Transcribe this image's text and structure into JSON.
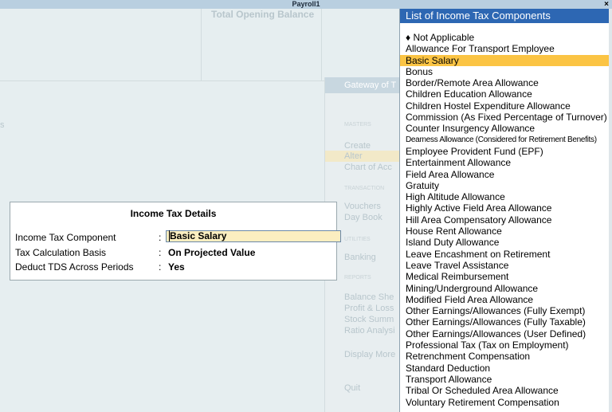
{
  "window": {
    "title": "Payroll1",
    "close_glyph": "×"
  },
  "background": {
    "top_panel_title": "Total Opening Balance",
    "left_label": "s",
    "gateway": {
      "header": "Gateway of T",
      "section_masters": "MASTERS",
      "create": "Create",
      "alter": "Alter",
      "chart": "Chart of Acc",
      "section_transactions": "TRANSACTION",
      "vouchers": "Vouchers",
      "daybook": "Day Book",
      "section_utilities": "UTILITIES",
      "banking": "Banking",
      "section_reports": "REPORTS",
      "balance_sheet": "Balance She",
      "profit_loss": "Profit & Loss",
      "stock_summary": "Stock Summ",
      "ratio": "Ratio Analysi",
      "display_more": "Display More",
      "quit": "Quit"
    }
  },
  "tax_details": {
    "title": "Income Tax Details",
    "rows": [
      {
        "label": "Income Tax Component",
        "colon": ":",
        "value": "Basic Salary"
      },
      {
        "label": "Tax Calculation Basis",
        "colon": ":",
        "value": "On Projected Value"
      },
      {
        "label": "Deduct TDS Across Periods",
        "colon": ":",
        "value": "Yes"
      }
    ],
    "cursor_char": "B",
    "value_rest": "asic Salary"
  },
  "list": {
    "title": "List of Income Tax Components",
    "items": [
      "♦ Not Applicable",
      "Allowance For Transport Employee",
      "Basic Salary",
      "Bonus",
      "Border/Remote Area Allowance",
      "Children Education Allowance",
      "Children Hostel Expenditure Allowance",
      "Commission (As Fixed Percentage of Turnover)",
      "Counter Insurgency Allowance",
      "Dearness Allowance (Considered for Retirement Benefits)",
      "Employee Provident Fund (EPF)",
      "Entertainment Allowance",
      "Field Area Allowance",
      "Gratuity",
      "High Altitude Allowance",
      "Highly Active Field Area Allowance",
      "Hill Area Compensatory Allowance",
      "House Rent Allowance",
      "Island Duty Allowance",
      "Leave Encashment on Retirement",
      "Leave Travel Assistance",
      "Medical Reimbursement",
      "Mining/Underground Allowance",
      "Modified Field Area Allowance",
      "Other Earnings/Allowances (Fully Exempt)",
      "Other Earnings/Allowances (Fully Taxable)",
      "Other Earnings/Allowances (User Defined)",
      "Professional Tax (Tax on Employment)",
      "Retrenchment Compensation",
      "Standard Deduction",
      "Transport Allowance",
      "Tribal Or Scheduled Area Allowance",
      "Voluntary Retirement Compensation"
    ],
    "selected_index": 2
  },
  "colors": {
    "list_header": "#2d67b3",
    "selection": "#fbc444",
    "input_bg": "#fbeec0"
  }
}
